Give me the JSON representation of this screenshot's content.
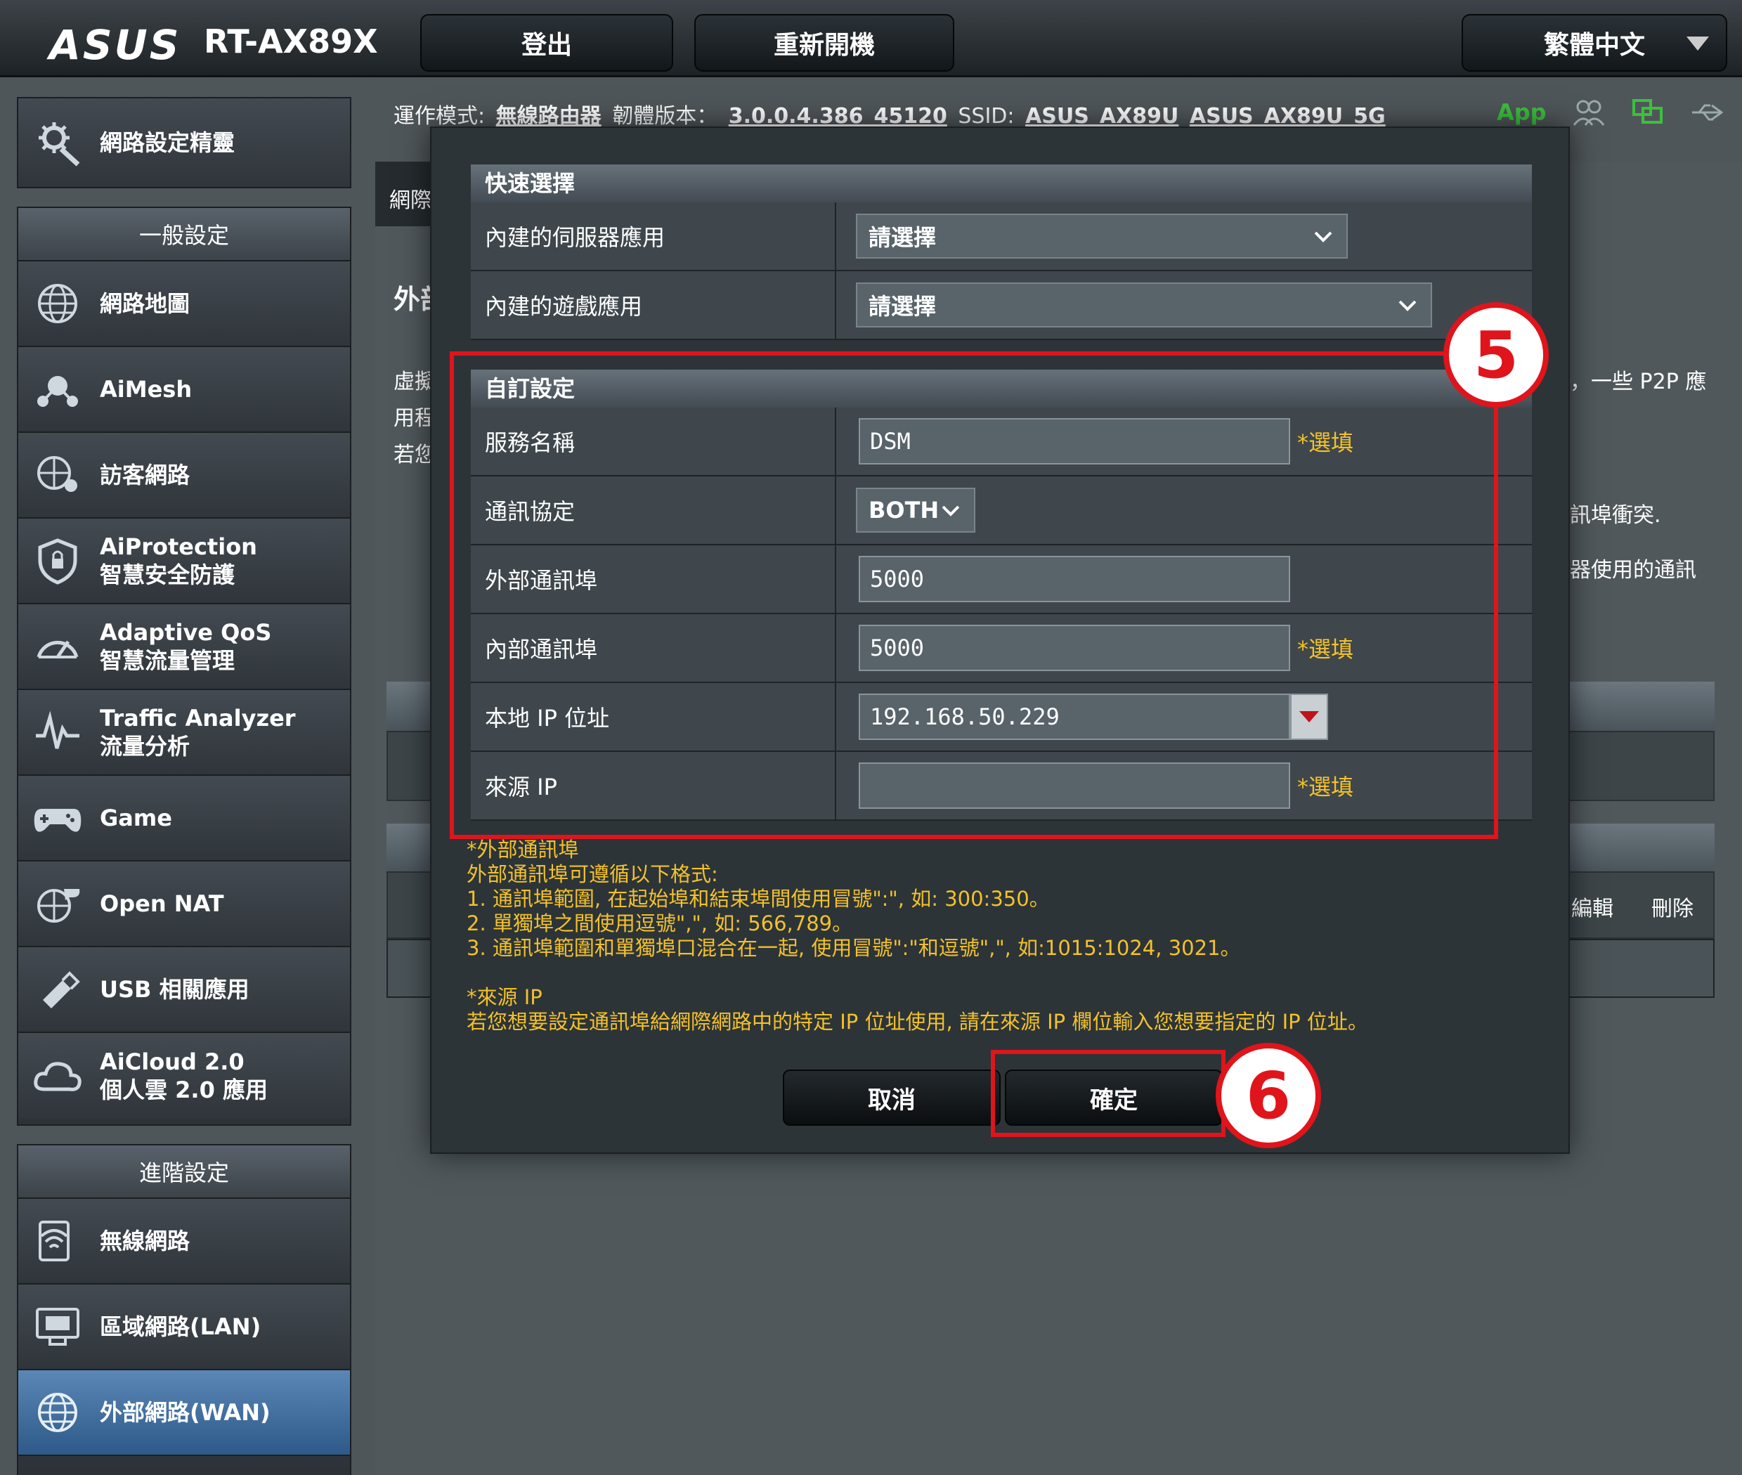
{
  "header": {
    "logo": "ASUS",
    "model": "RT-AX89X",
    "logout_label": "登出",
    "reboot_label": "重新開機",
    "language": "繁體中文"
  },
  "infobar": {
    "mode_label": "運作模式:",
    "mode_value": "無線路由器",
    "firmware_label": "韌體版本：",
    "firmware_value": "3.0.0.4.386_45120",
    "ssid_label": "SSID:",
    "ssid_1": "ASUS_AX89U",
    "ssid_2": "ASUS_AX89U_5G",
    "app_label": "App"
  },
  "sidebar": {
    "wizard_label": "網路設定精靈",
    "general_title": "一般設定",
    "general_items": [
      {
        "label": "網路地圖",
        "icon": "globe-icon"
      },
      {
        "label": "AiMesh",
        "icon": "aimesh-icon"
      },
      {
        "label": "訪客網路",
        "icon": "guest-network-icon"
      },
      {
        "label": "AiProtection",
        "sub": "智慧安全防護",
        "icon": "shield-icon"
      },
      {
        "label": "Adaptive QoS",
        "sub": "智慧流量管理",
        "icon": "gauge-icon"
      },
      {
        "label": "Traffic Analyzer",
        "sub": "流量分析",
        "icon": "traffic-icon"
      },
      {
        "label": "Game",
        "icon": "gamepad-icon"
      },
      {
        "label": "Open NAT",
        "icon": "open-nat-icon"
      },
      {
        "label": "USB 相關應用",
        "icon": "usb-icon"
      },
      {
        "label": "AiCloud 2.0",
        "sub": "個人雲 2.0 應用",
        "icon": "cloud-icon"
      }
    ],
    "advanced_title": "進階設定",
    "advanced_items": [
      {
        "label": "無線網路",
        "icon": "wireless-icon"
      },
      {
        "label": "區域網路(LAN)",
        "icon": "lan-icon"
      },
      {
        "label": "外部網路(WAN)",
        "icon": "wan-icon"
      }
    ]
  },
  "background": {
    "tab_text": "網際",
    "page_title": "外部",
    "desc_lines": [
      "虛擬",
      "用程",
      "若您"
    ],
    "right_text_1": "，一些 P2P 應",
    "right_text_2": "訊埠衝突.",
    "right_text_3": "器使用的通訊",
    "col_edit": "編輯",
    "col_delete": "刪除"
  },
  "modal": {
    "quick_title": "快速選擇",
    "quick_rows": [
      {
        "label": "內建的伺服器應用",
        "value": "請選擇"
      },
      {
        "label": "內建的遊戲應用",
        "value": "請選擇"
      }
    ],
    "custom_title": "自訂設定",
    "service_name_label": "服務名稱",
    "service_name_value": "DSM",
    "protocol_label": "通訊協定",
    "protocol_value": "BOTH",
    "ext_port_label": "外部通訊埠",
    "ext_port_value": "5000",
    "int_port_label": "內部通訊埠",
    "int_port_value": "5000",
    "local_ip_label": "本地 IP 位址",
    "local_ip_value": "192.168.50.229",
    "source_ip_label": "來源 IP",
    "source_ip_value": "",
    "optional": "*選填",
    "notes": [
      "*外部通訊埠",
      "外部通訊埠可遵循以下格式:",
      "1. 通訊埠範圍, 在起始埠和結束埠間使用冒號\":\", 如: 300:350。",
      "2. 單獨埠之間使用逗號\",\", 如: 566,789。",
      "3. 通訊埠範圍和單獨埠口混合在一起, 使用冒號\":\"和逗號\",\", 如:1015:1024, 3021。",
      "",
      "*來源 IP",
      "若您想要設定通訊埠給網際網路中的特定 IP 位址使用, 請在來源 IP 欄位輸入您想要指定的 IP 位址。"
    ],
    "cancel_label": "取消",
    "ok_label": "確定"
  },
  "annotations": {
    "step5": "5",
    "step6": "6"
  },
  "colors": {
    "accent_red": "#e0141b",
    "optional_yellow": "#f3c12a",
    "active_blue": "#3b6a9a"
  }
}
